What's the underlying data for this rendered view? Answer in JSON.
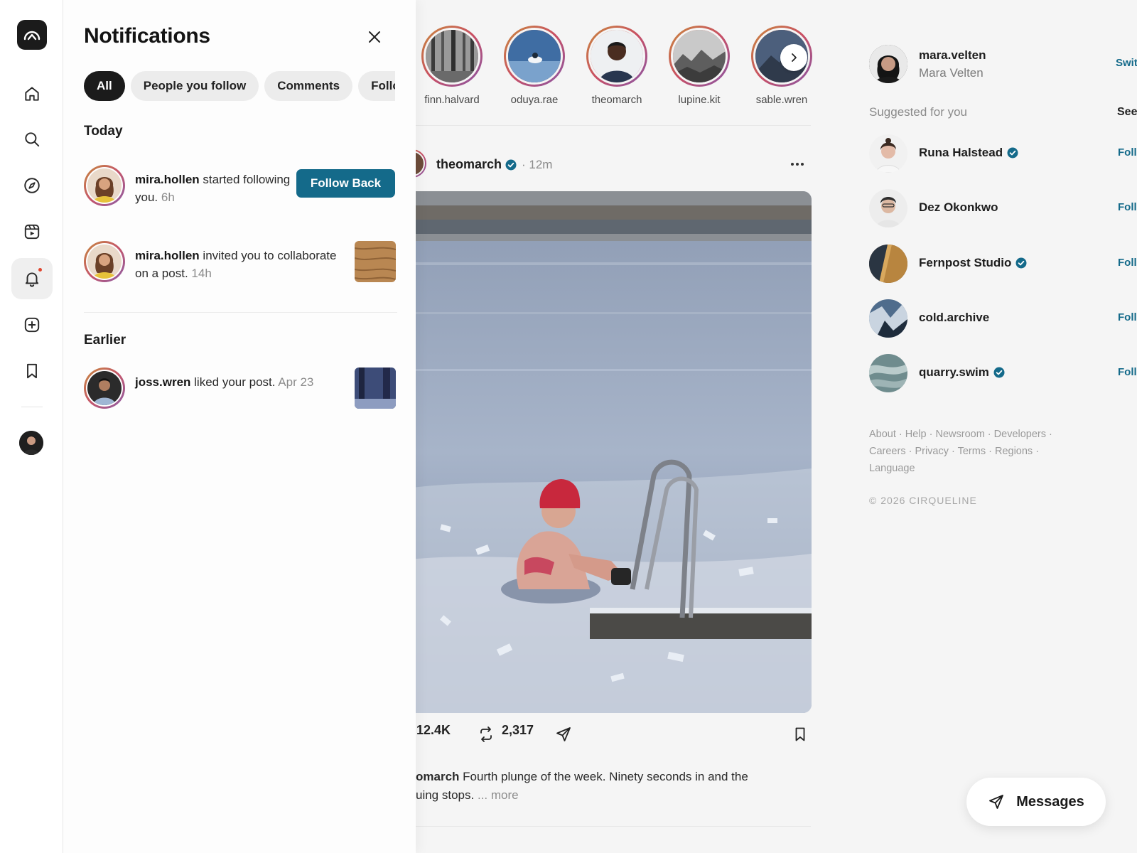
{
  "app": {
    "brand_color": "#146a8a",
    "accent_dot": "#e0462f"
  },
  "rail": {
    "items": [
      {
        "name": "home",
        "icon": "home-icon"
      },
      {
        "name": "search",
        "icon": "search-icon"
      },
      {
        "name": "explore",
        "icon": "compass-icon"
      },
      {
        "name": "reels",
        "icon": "reels-icon"
      },
      {
        "name": "notifications",
        "icon": "bell-icon",
        "active": true,
        "has_dot": true
      },
      {
        "name": "create",
        "icon": "plus-square-icon"
      },
      {
        "name": "saved",
        "icon": "bookmark-icon"
      }
    ]
  },
  "notifications": {
    "title": "Notifications",
    "filters": [
      "All",
      "People you follow",
      "Comments",
      "Follows"
    ],
    "active_filter": "All",
    "today_label": "Today",
    "earlier_label": "Earlier",
    "today": [
      {
        "user": "mira.hollen",
        "text": "started following you.",
        "time": "6h",
        "action": "Follow Back"
      },
      {
        "user": "mira.hollen",
        "text": "invited you to collaborate on a post.",
        "time": "14h"
      }
    ],
    "earlier": [
      {
        "user": "joss.wren",
        "text": "liked your post.",
        "time": "Apr 23"
      }
    ]
  },
  "stories": [
    "finn.halvard",
    "oduya.rae",
    "theomarch",
    "lupine.kit",
    "sable.wren"
  ],
  "post": {
    "user": "theomarch",
    "time": "12m",
    "likes": "12.4K",
    "reposts": "2,317",
    "caption_user": "omarch",
    "caption_text": "Fourth plunge of the week. Ninety seconds in and the",
    "caption_text2": "uing stops.",
    "more_label": "... more"
  },
  "sidebar": {
    "me": {
      "username": "mara.velten",
      "name": "Mara Velten",
      "switch_label": "Switch"
    },
    "suggested_label": "Suggested for you",
    "see_all_label": "See All",
    "suggestions": [
      {
        "name": "Runa Halstead",
        "verified": true,
        "follow": "Follow"
      },
      {
        "name": "Dez Okonkwo",
        "verified": false,
        "follow": "Follow"
      },
      {
        "name": "Fernpost Studio",
        "verified": true,
        "follow": "Follow"
      },
      {
        "name": "cold.archive",
        "verified": false,
        "follow": "Follow"
      },
      {
        "name": "quarry.swim",
        "verified": true,
        "follow": "Follow"
      }
    ],
    "footer_line1": "About · Help · Newsroom · Developers ·",
    "footer_line2": "Careers · Privacy · Terms · Regions ·",
    "footer_line3": "Language",
    "copyright": "© 2026 CIRQUELINE"
  },
  "messages": {
    "label": "Messages"
  }
}
